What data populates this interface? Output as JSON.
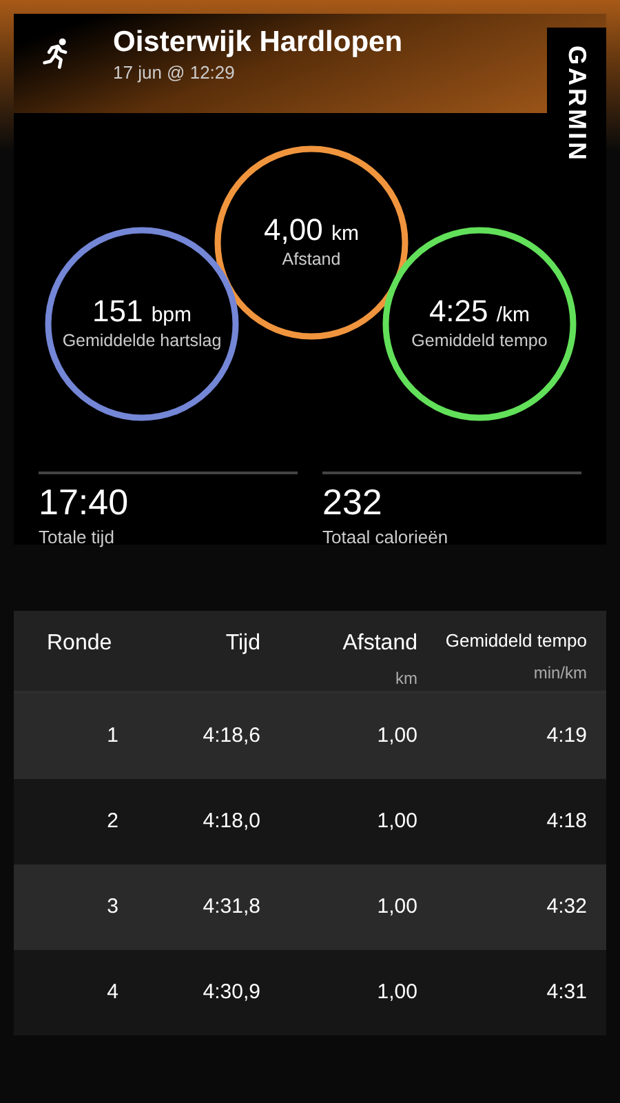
{
  "activity": {
    "title": "Oisterwijk Hardlopen",
    "date": "17 jun @ 12:29",
    "brand": "GARMIN"
  },
  "circles": [
    {
      "value": "4,00",
      "unit": "km",
      "label": "Afstand",
      "color": "#f0953e"
    },
    {
      "value": "151",
      "unit": "bpm",
      "label": "Gemiddelde hartslag",
      "color": "#7486d6"
    },
    {
      "value": "4:25",
      "unit": "/km",
      "label": "Gemiddeld tempo",
      "color": "#62e05a"
    }
  ],
  "stats": [
    {
      "value": "17:40",
      "label": "Totale tijd"
    },
    {
      "value": "232",
      "label": "Totaal calorieën"
    }
  ],
  "table": {
    "columns": [
      {
        "title": "Ronde"
      },
      {
        "title": "Tijd"
      },
      {
        "title": "Afstand",
        "unit": "km"
      },
      {
        "title": "Gemiddeld tempo",
        "unit": "min/km"
      }
    ],
    "rows": [
      [
        "1",
        "4:18,6",
        "1,00",
        "4:19"
      ],
      [
        "2",
        "4:18,0",
        "1,00",
        "4:18"
      ],
      [
        "3",
        "4:31,8",
        "1,00",
        "4:32"
      ],
      [
        "4",
        "4:30,9",
        "1,00",
        "4:31"
      ]
    ]
  }
}
